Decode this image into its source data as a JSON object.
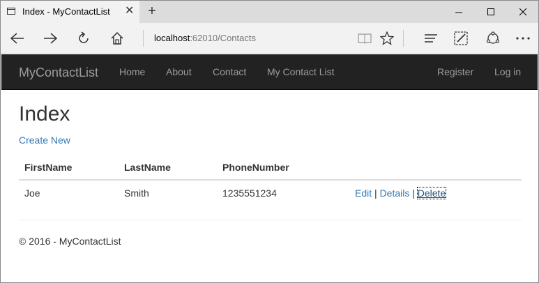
{
  "browser": {
    "tab_title": "Index - MyContactList",
    "address_host": "localhost",
    "address_path": ":62010/Contacts"
  },
  "site": {
    "brand": "MyContactList",
    "nav": [
      "Home",
      "About",
      "Contact",
      "My Contact List"
    ],
    "nav_right": [
      "Register",
      "Log in"
    ]
  },
  "page": {
    "title": "Index",
    "create_link": "Create New",
    "columns": [
      "FirstName",
      "LastName",
      "PhoneNumber"
    ],
    "rows": [
      {
        "first": "Joe",
        "last": "Smith",
        "phone": "1235551234",
        "actions": {
          "edit": "Edit",
          "details": "Details",
          "delete": "Delete",
          "sep": "|"
        }
      }
    ],
    "footer": "© 2016 - MyContactList"
  },
  "colors": {
    "navbar_bg": "#222222",
    "nav_text": "#9d9d9d",
    "link": "#337ab7"
  },
  "icons": [
    "tab-page-icon",
    "close-icon",
    "plus-icon",
    "minimize-icon",
    "maximize-icon",
    "close-window-icon",
    "back-icon",
    "forward-icon",
    "refresh-icon",
    "home-icon",
    "reading-view-icon",
    "favorite-star-icon",
    "hub-icon",
    "web-note-icon",
    "share-icon",
    "more-icon"
  ]
}
